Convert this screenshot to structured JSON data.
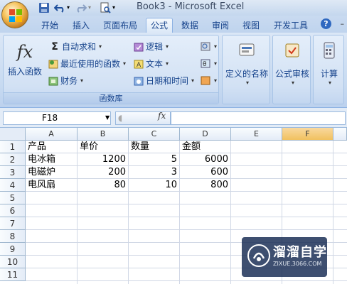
{
  "window": {
    "title": "Book3 - Microsoft Excel"
  },
  "tabs": [
    {
      "label": "开始"
    },
    {
      "label": "插入"
    },
    {
      "label": "页面布局"
    },
    {
      "label": "公式",
      "active": true
    },
    {
      "label": "数据"
    },
    {
      "label": "审阅"
    },
    {
      "label": "视图"
    },
    {
      "label": "开发工具"
    }
  ],
  "ribbon": {
    "function_library": {
      "insert_function": "插入函数",
      "autosum": "自动求和",
      "recently_used": "最近使用的函数",
      "financial": "财务",
      "logical": "逻辑",
      "text": "文本",
      "date_time": "日期和时间",
      "group_label": "函数库"
    },
    "defined_names": "定义的名称",
    "formula_auditing": "公式审核",
    "calculation": "计算"
  },
  "formula_bar": {
    "name_box": "F18",
    "fx": "fx",
    "formula": ""
  },
  "grid": {
    "columns": [
      "A",
      "B",
      "C",
      "D",
      "E",
      "F"
    ],
    "selected_column": "F",
    "rows": [
      "1",
      "2",
      "3",
      "4",
      "5",
      "6",
      "7",
      "8",
      "9",
      "10",
      "11"
    ],
    "cells": {
      "A1": "产品",
      "B1": "单价",
      "C1": "数量",
      "D1": "金额",
      "A2": "电冰箱",
      "B2": "1200",
      "C2": "5",
      "D2": "6000",
      "A3": "电磁炉",
      "B3": "200",
      "C3": "3",
      "D3": "600",
      "A4": "电风扇",
      "B4": "80",
      "C4": "10",
      "D4": "800"
    }
  },
  "watermark": {
    "text": "溜溜自学",
    "sub": "ZIXUE.3066.COM"
  },
  "colors": {
    "ribbon_text": "#15428b",
    "selected_header": "#f1c15f",
    "grid_line": "#d0d7e5"
  }
}
